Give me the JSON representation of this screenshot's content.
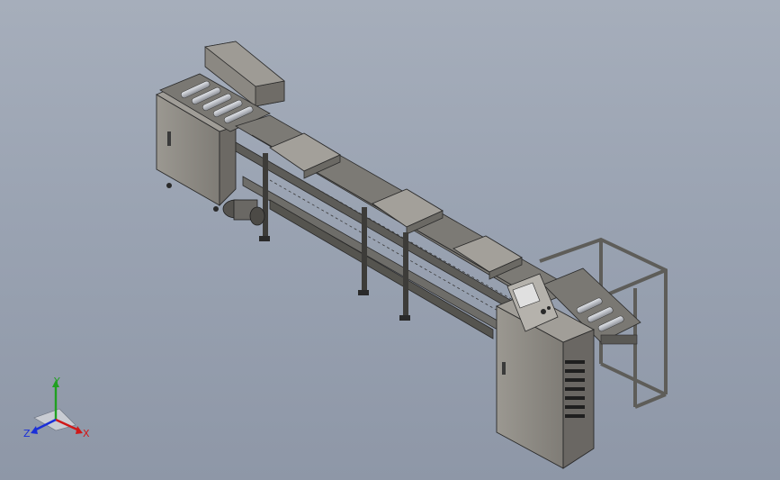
{
  "viewport": {
    "background_top": "#a6aebb",
    "background_bottom": "#8e97a7"
  },
  "model": {
    "description_visible": false,
    "colors": {
      "cabinet": "#8f8c86",
      "frame": "#6b6a66",
      "roller": "#c9ccd2",
      "dark": "#2a2a2a"
    },
    "parts": [
      "left-cabinet",
      "top-hood",
      "roller-bed-left",
      "conveyor-main",
      "carrier-plate-1",
      "carrier-plate-2",
      "carrier-plate-3",
      "support-legs",
      "motor-unit",
      "control-cabinet",
      "hmi-panel",
      "vent-grille",
      "right-frame",
      "roller-bed-right"
    ]
  },
  "triad": {
    "x_label": "X",
    "y_label": "Y",
    "z_label": "Z",
    "x_color": "#d01818",
    "y_color": "#20a020",
    "z_color": "#1a2fd8"
  }
}
